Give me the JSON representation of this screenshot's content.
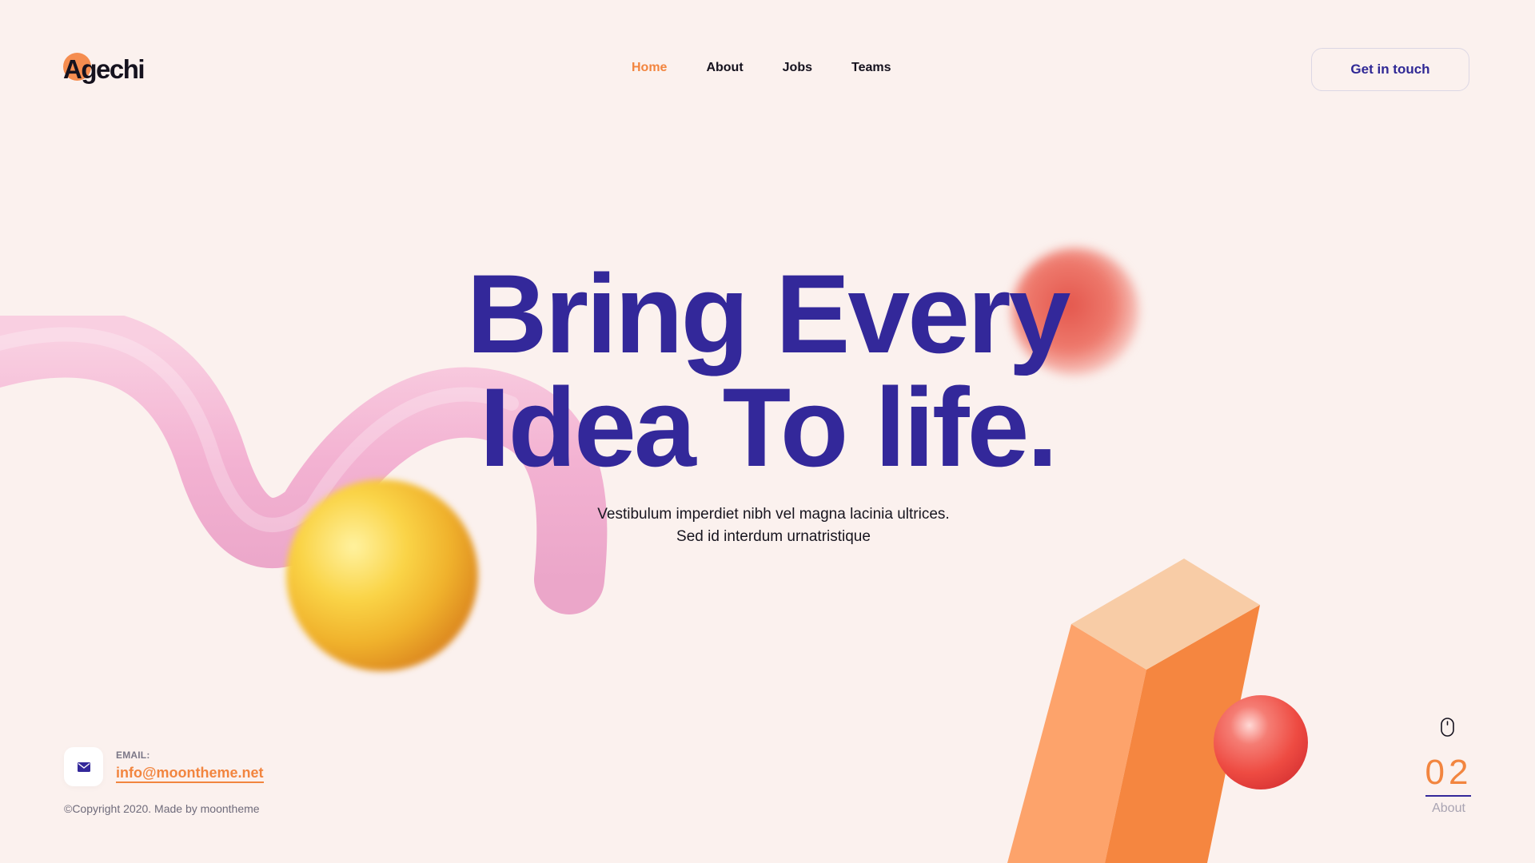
{
  "header": {
    "logo_text": "Agechi",
    "nav": [
      {
        "label": "Home",
        "active": true
      },
      {
        "label": "About",
        "active": false
      },
      {
        "label": "Jobs",
        "active": false
      },
      {
        "label": "Teams",
        "active": false
      }
    ],
    "cta_label": "Get in touch"
  },
  "hero": {
    "title_line1": "Bring Every",
    "title_line2": "Idea To life.",
    "subtitle_line1": "Vestibulum imperdiet nibh vel magna lacinia ultrices.",
    "subtitle_line2": "Sed id interdum urnatristique"
  },
  "footer": {
    "email_label": "EMAIL:",
    "email": "info@moontheme.net",
    "copyright": "©Copyright 2020. Made by moontheme"
  },
  "pager": {
    "number": "02",
    "label": "About",
    "icon": "mouse-icon"
  },
  "colors": {
    "background": "#fbf1ee",
    "accent": "#f2853f",
    "primary": "#33289a"
  }
}
